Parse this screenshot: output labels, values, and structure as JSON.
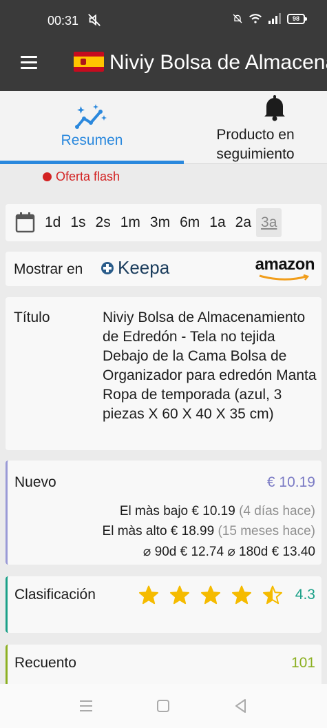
{
  "status_bar": {
    "time": "00:31",
    "battery": "98"
  },
  "app_bar": {
    "title": "Niviy Bolsa de Almacenamiento de Edredón"
  },
  "tabs": [
    {
      "label": "Resumen",
      "active": true
    },
    {
      "label": "Producto en seguimiento",
      "active": false
    }
  ],
  "flash_offer": "Oferta flash",
  "ranges": [
    {
      "label": "1d"
    },
    {
      "label": "1s"
    },
    {
      "label": "2s"
    },
    {
      "label": "1m"
    },
    {
      "label": "3m"
    },
    {
      "label": "6m"
    },
    {
      "label": "1a"
    },
    {
      "label": "2a"
    },
    {
      "label": "3a",
      "active": true
    }
  ],
  "show_in": {
    "label": "Mostrar en",
    "keepa": "Keepa",
    "amazon": "amazon"
  },
  "title_row": {
    "label": "Título",
    "value": "Niviy Bolsa de Almacenamiento de Edredón - Tela no tejida Debajo de la Cama Bolsa de Organizador para edredón Manta Ropa de temporada (azul, 3 piezas X 60 X 40 X 35 cm)"
  },
  "price": {
    "label": "Nuevo",
    "current": "€ 10.19",
    "lowest_label": "El màs bajo",
    "lowest_value": "€ 10.19",
    "lowest_when": "(4 días hace)",
    "highest_label": "El màs alto",
    "highest_value": "€ 18.99",
    "highest_when": "(15 meses hace)",
    "avg90_label": "⌀ 90d",
    "avg90_value": "€ 12.74",
    "avg180_label": "⌀ 180d",
    "avg180_value": "€ 13.40"
  },
  "rating": {
    "label": "Clasificación",
    "score": "4.3",
    "stars": 4.3
  },
  "count": {
    "label": "Recuento",
    "value": "101"
  },
  "colors": {
    "bar": "#3a3a3a",
    "accent": "#2a88dd",
    "price": "#7a7ac4",
    "rating": "#1aa088",
    "count": "#8cb022",
    "flash": "#d32222",
    "star": "#f5bb00"
  }
}
